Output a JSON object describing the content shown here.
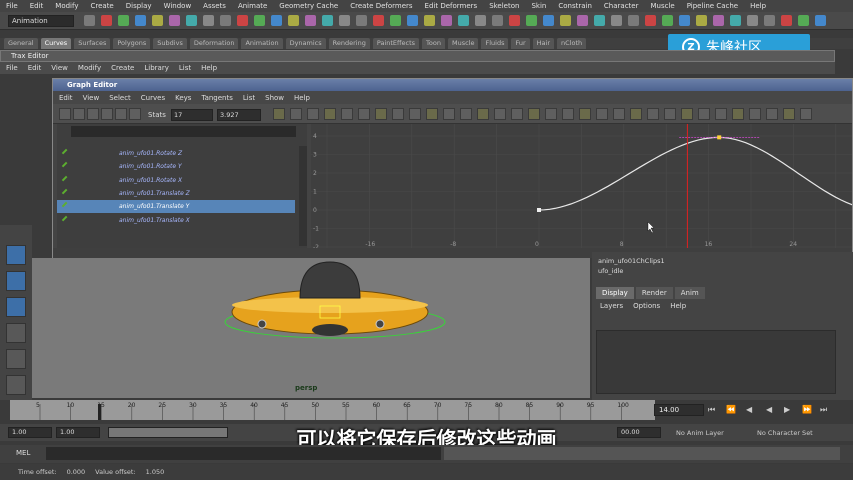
{
  "menubar": [
    "File",
    "Edit",
    "Modify",
    "Create",
    "Display",
    "Window",
    "Assets",
    "Animate",
    "Geometry Cache",
    "Create Deformers",
    "Edit Deformers",
    "Skeleton",
    "Skin",
    "Constrain",
    "Character",
    "Muscle",
    "Pipeline Cache",
    "Help"
  ],
  "mode_selector": "Animation",
  "shelf_tabs": [
    "General",
    "Curves",
    "Surfaces",
    "Polygons",
    "Subdivs",
    "Deformation",
    "Animation",
    "Dynamics",
    "Rendering",
    "PaintEffects",
    "Toon",
    "Muscle",
    "Fluids",
    "Fur",
    "Hair",
    "nCloth"
  ],
  "shelf_active": 1,
  "watermark": {
    "text": "朱峰社区",
    "letter": "Z"
  },
  "trax": {
    "title": "Trax Editor",
    "menu": [
      "File",
      "Edit",
      "View",
      "Modify",
      "Create",
      "Library",
      "List",
      "Help"
    ]
  },
  "graph_editor": {
    "title": "Graph Editor",
    "menu": [
      "Edit",
      "View",
      "Select",
      "Curves",
      "Keys",
      "Tangents",
      "List",
      "Show",
      "Help"
    ],
    "stats_label": "Stats",
    "stats_frame": "17",
    "stats_value": "3.927",
    "channels": [
      {
        "label": "anim_ufo01.Rotate Z",
        "selected": false
      },
      {
        "label": "anim_ufo01.Rotate Y",
        "selected": false
      },
      {
        "label": "anim_ufo01.Rotate X",
        "selected": false
      },
      {
        "label": "anim_ufo01.Translate Z",
        "selected": false
      },
      {
        "label": "anim_ufo01.Translate Y",
        "selected": true
      },
      {
        "label": "anim_ufo01.Translate X",
        "selected": false
      }
    ],
    "x_ticks": [
      "-24",
      "-16",
      "-8",
      "0",
      "8",
      "16",
      "24",
      "32",
      "40"
    ],
    "x_ticks_screen": [
      "16",
      "24",
      "32"
    ],
    "y_ticks": [
      "4",
      "3",
      "2",
      "1",
      "0",
      "-1",
      "-2",
      "-3"
    ],
    "curve_keys": [
      [
        0,
        0
      ],
      [
        17,
        3.927
      ],
      [
        32,
        0
      ]
    ],
    "current_time": 14
  },
  "viewport": {
    "camera_label": "persp"
  },
  "right_panel": {
    "clip_field": "anim_ufo01ChClips1",
    "clip_field2": "ufo_idle",
    "tabs": [
      "Display",
      "Render",
      "Anim"
    ],
    "active_tab": 0,
    "menu": [
      "Layers",
      "Options",
      "Help"
    ]
  },
  "timeline": {
    "ticks": [
      "5",
      "10",
      "15",
      "20",
      "25",
      "30",
      "35",
      "40",
      "45",
      "50",
      "55",
      "60",
      "65",
      "70",
      "75",
      "80",
      "85",
      "90",
      "95",
      "100"
    ],
    "current_frame": "14.00"
  },
  "range": {
    "start": "1.00",
    "start2": "1.00",
    "end": "00.00",
    "anim_layer": "No Anim Layer",
    "character_set": "No Character Set"
  },
  "subtitle": "可以将它保存后修改这些动画",
  "mel_label": "MEL",
  "status": {
    "time_offset": "Time offset:",
    "time_val": "0.000",
    "value_offset": "Value offset:",
    "value_val": "1.050"
  },
  "colors": {
    "accent": "#2a9fd8",
    "selected_row": "#5785b8",
    "ufo_body": "#e6a21d",
    "curve": "#e8e8e8",
    "time_line": "#e02020"
  }
}
